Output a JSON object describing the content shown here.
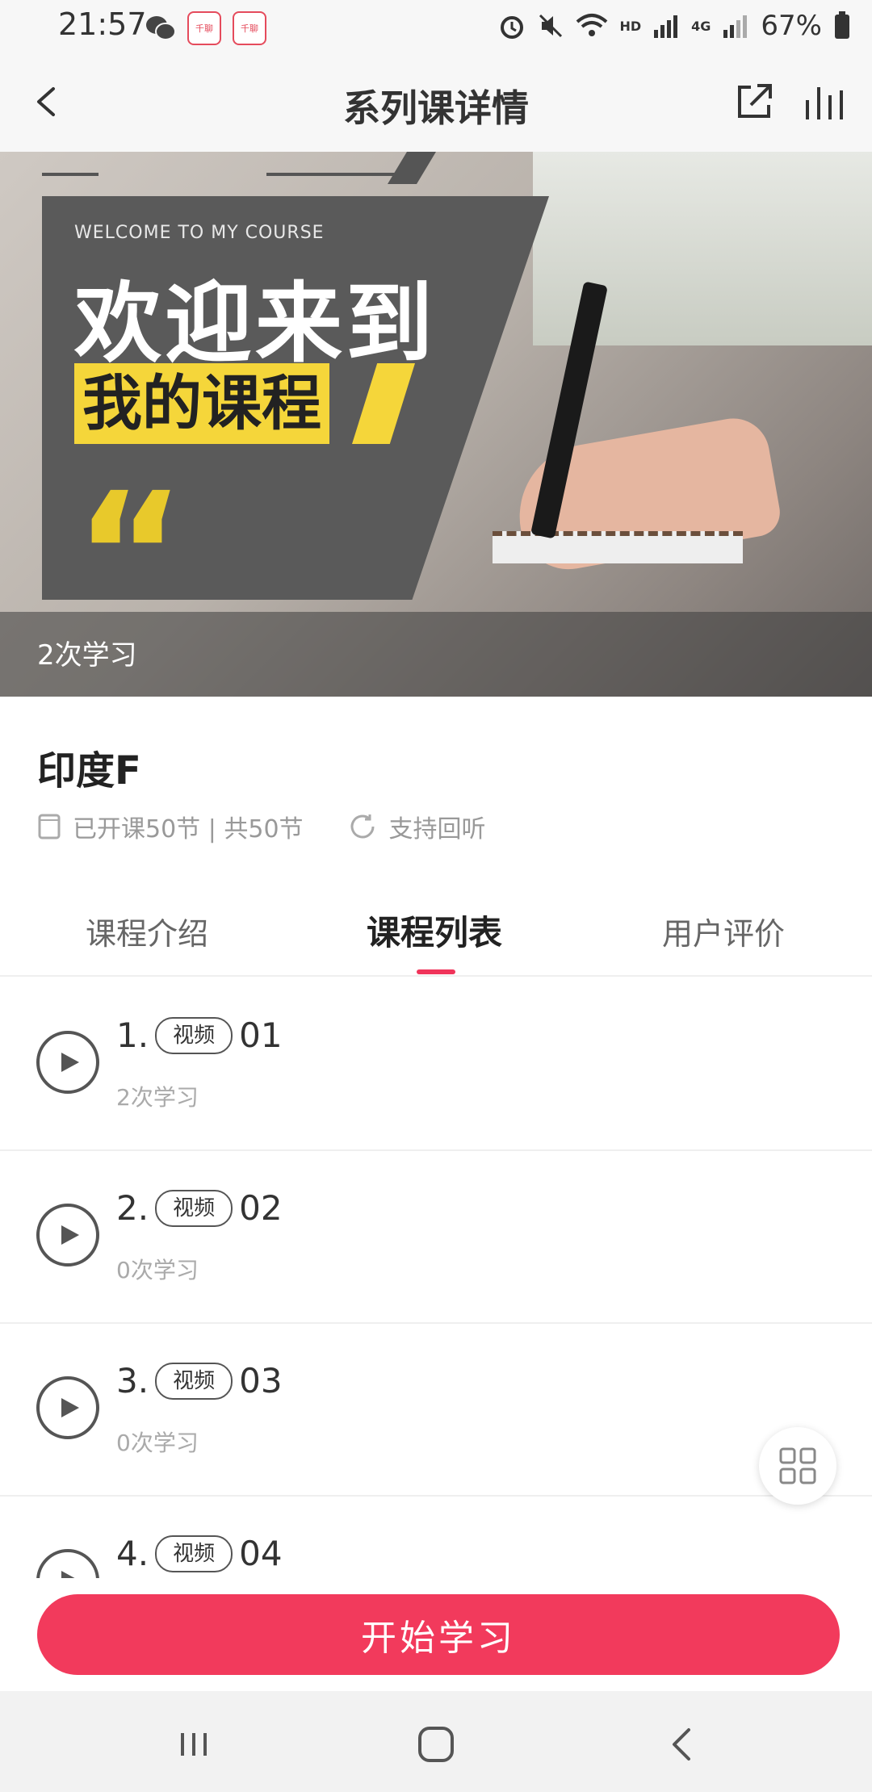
{
  "status_bar": {
    "time": "21:57",
    "app_icon_label": "千聊",
    "hd_label": "HD",
    "network_label": "4G",
    "battery": "67%"
  },
  "header": {
    "title": "系列课详情"
  },
  "banner": {
    "small_text": "WELCOME TO MY COURSE",
    "big_text": "欢迎来到",
    "yellow_text": "我的课程",
    "quote_mark": "“",
    "caption": "2次学习"
  },
  "course": {
    "title": "印度F",
    "lessons_info": "已开课50节 | 共50节",
    "replay_info": "支持回听"
  },
  "tabs": [
    {
      "label": "课程介绍"
    },
    {
      "label": "课程列表"
    },
    {
      "label": "用户评价"
    }
  ],
  "lessons": [
    {
      "index": "1.",
      "tag": "视频",
      "title": "01",
      "study_count": "2次学习"
    },
    {
      "index": "2.",
      "tag": "视频",
      "title": "02",
      "study_count": "0次学习"
    },
    {
      "index": "3.",
      "tag": "视频",
      "title": "03",
      "study_count": "0次学习"
    },
    {
      "index": "4.",
      "tag": "视频",
      "title": "04",
      "study_count": ""
    }
  ],
  "start_button": {
    "label": "开始学习"
  },
  "colors": {
    "accent": "#f23a5c",
    "banner_yellow": "#f5d63a"
  },
  "icons": {
    "back": "chevron-left-icon",
    "share": "share-external-icon",
    "stats": "bar-chart-icon",
    "lessons": "document-icon",
    "replay": "refresh-icon",
    "play": "play-circle-icon",
    "grid": "grid-icon"
  }
}
